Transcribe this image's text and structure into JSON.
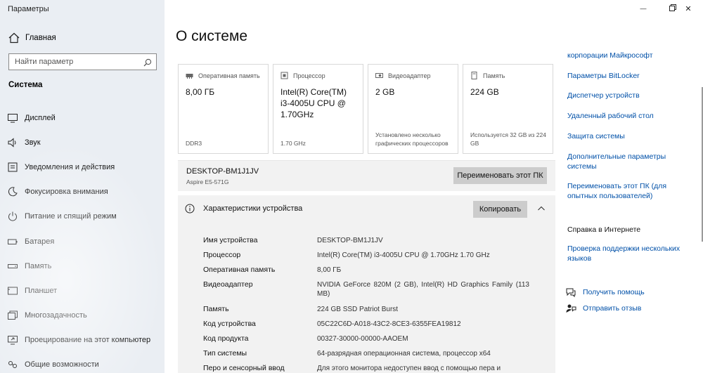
{
  "window": {
    "title": "Параметры",
    "controls": {
      "minimize": "—",
      "maximize": "□",
      "close": "✕"
    }
  },
  "sidebar": {
    "home_label": "Главная",
    "search_placeholder": "Найти параметр",
    "section_label": "Система",
    "items": [
      {
        "label": "Дисплей",
        "icon": "display-icon"
      },
      {
        "label": "Звук",
        "icon": "sound-icon"
      },
      {
        "label": "Уведомления и действия",
        "icon": "notifications-icon"
      },
      {
        "label": "Фокусировка внимания",
        "icon": "focus-assist-icon"
      },
      {
        "label": "Питание и спящий режим",
        "icon": "power-icon"
      },
      {
        "label": "Батарея",
        "icon": "battery-icon"
      },
      {
        "label": "Память",
        "icon": "storage-icon"
      },
      {
        "label": "Планшет",
        "icon": "tablet-icon"
      },
      {
        "label": "Многозадачность",
        "icon": "multitasking-icon"
      },
      {
        "label": "Проецирование на этот компьютер",
        "icon": "projecting-icon"
      },
      {
        "label": "Общие возможности",
        "icon": "shared-experiences-icon"
      }
    ]
  },
  "main": {
    "title": "О системе",
    "cards": [
      {
        "label": "Оперативная память",
        "value": "8,00 ГБ",
        "footer": "DDR3",
        "icon": "ram-icon"
      },
      {
        "label": "Процессор",
        "value": "Intel(R) Core(TM) i3-4005U CPU @ 1.70GHz",
        "footer": "1.70 GHz",
        "icon": "processor-icon"
      },
      {
        "label": "Видеоадаптер",
        "value": "2 GB",
        "footer": "Установлено несколько графических процессоров",
        "icon": "graphics-icon"
      },
      {
        "label": "Память",
        "value": "224 GB",
        "footer": "Используется 32 GB из 224 GB",
        "icon": "storage-card-icon"
      }
    ],
    "pc": {
      "name": "DESKTOP-BM1J1JV",
      "model": "Aspire E5-571G",
      "rename_label": "Переименовать этот ПК"
    },
    "specs": {
      "title": "Характеристики устройства",
      "copy_label": "Копировать",
      "rows": [
        {
          "key": "Имя устройства",
          "value": "DESKTOP-BM1J1JV"
        },
        {
          "key": "Процессор",
          "value": "Intel(R) Core(TM) i3-4005U CPU @ 1.70GHz   1.70 GHz"
        },
        {
          "key": "Оперативная память",
          "value": "8,00 ГБ"
        },
        {
          "key": "Видеоадаптер",
          "value": "NVIDIA GeForce 820M (2 GB), Intel(R) HD Graphics Family (113 MB)"
        },
        {
          "key": "Память",
          "value": "224 GB SSD Patriot Burst"
        },
        {
          "key": "Код устройства",
          "value": "05C22C6D-A018-43C2-8CE3-6355FEA19812"
        },
        {
          "key": "Код продукта",
          "value": "00327-30000-00000-AAOEM"
        },
        {
          "key": "Тип системы",
          "value": "64-разрядная операционная система, процессор x64"
        },
        {
          "key": "Перо и сенсорный ввод",
          "value": "Для этого монитора недоступен ввод с помощью пера и"
        }
      ]
    }
  },
  "right": {
    "links": [
      "корпорации Майкрософт",
      "Параметры BitLocker",
      "Диспетчер устройств",
      "Удаленный рабочий стол",
      "Защита системы",
      "Дополнительные параметры системы",
      "Переименовать этот ПК (для опытных пользователей)"
    ],
    "web_help_heading": "Справка в Интернете",
    "web_help_link": "Проверка поддержки нескольких языков",
    "get_help": "Получить помощь",
    "give_feedback": "Отправить отзыв"
  }
}
